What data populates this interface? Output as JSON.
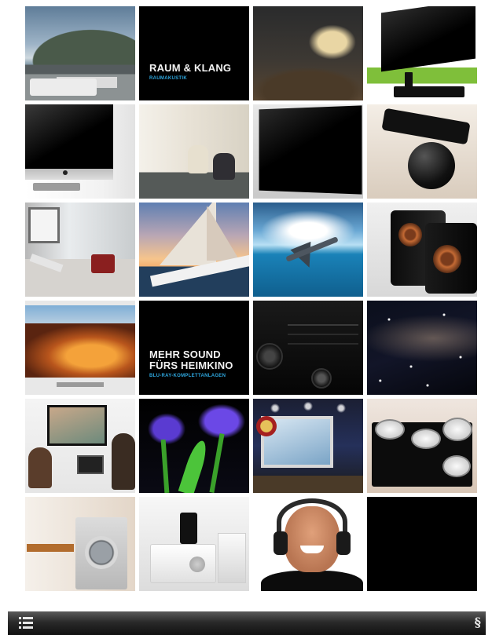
{
  "tiles": {
    "raum_klang": {
      "title_line1": "RAUM & KLANG",
      "subtitle": "RAUMAKUSTIK"
    },
    "mehr_sound": {
      "title_line1": "MEHR SOUND",
      "title_line2": "FÜRS HEIMKINO",
      "subtitle": "BLU-RAY-KOMPLETTANLAGEN"
    }
  },
  "bottom_bar": {
    "menu_icon": "list-menu-icon",
    "logo_glyph": "§"
  },
  "colors": {
    "subtitle_accent": "#2ea8e0",
    "bar_dark": "#111111"
  }
}
